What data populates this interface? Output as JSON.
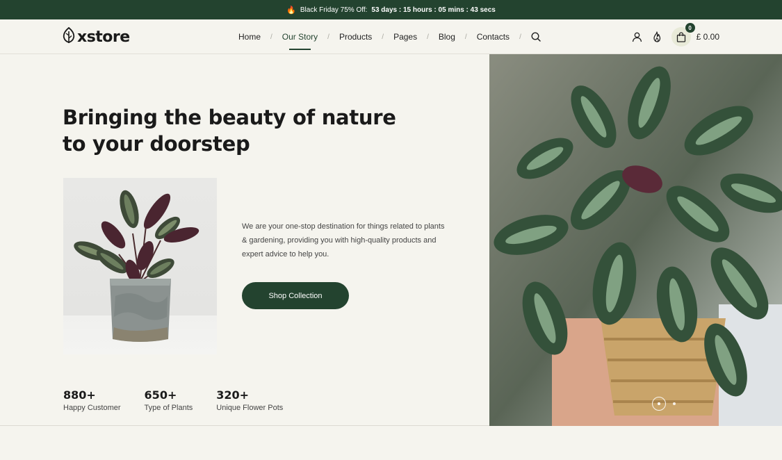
{
  "announcement": {
    "icon": "fire-icon",
    "text": "Black Friday 75% Off:",
    "countdown": "53 days : 15 hours : 05 mins : 43 secs"
  },
  "brand": {
    "logo_text": "xstore"
  },
  "nav": {
    "items": [
      {
        "label": "Home",
        "active": false
      },
      {
        "label": "Our Story",
        "active": true
      },
      {
        "label": "Products",
        "active": false
      },
      {
        "label": "Pages",
        "active": false
      },
      {
        "label": "Blog",
        "active": false
      },
      {
        "label": "Contacts",
        "active": false
      }
    ],
    "separator": "/"
  },
  "header_actions": {
    "cart_count": "0",
    "cart_total": "£ 0.00",
    "icons": [
      "search-icon",
      "user-icon",
      "fire-icon",
      "shopping-bag-icon"
    ]
  },
  "hero": {
    "title_line1": "Bringing the beauty of nature",
    "title_line2": "to your doorstep",
    "description": "We are your one-stop destination for things related to plants & gardening, providing you with high-quality products and expert advice to help you.",
    "cta_label": "Shop Collection"
  },
  "stats": [
    {
      "value": "880+",
      "label": "Happy Customer"
    },
    {
      "value": "650+",
      "label": "Type of Plants"
    },
    {
      "value": "320+",
      "label": "Unique Flower Pots"
    }
  ],
  "colors": {
    "accent": "#23432f",
    "background": "#f5f4ee",
    "cart_bg": "#e8ead8"
  },
  "slider": {
    "slides": 2,
    "active": 1
  }
}
